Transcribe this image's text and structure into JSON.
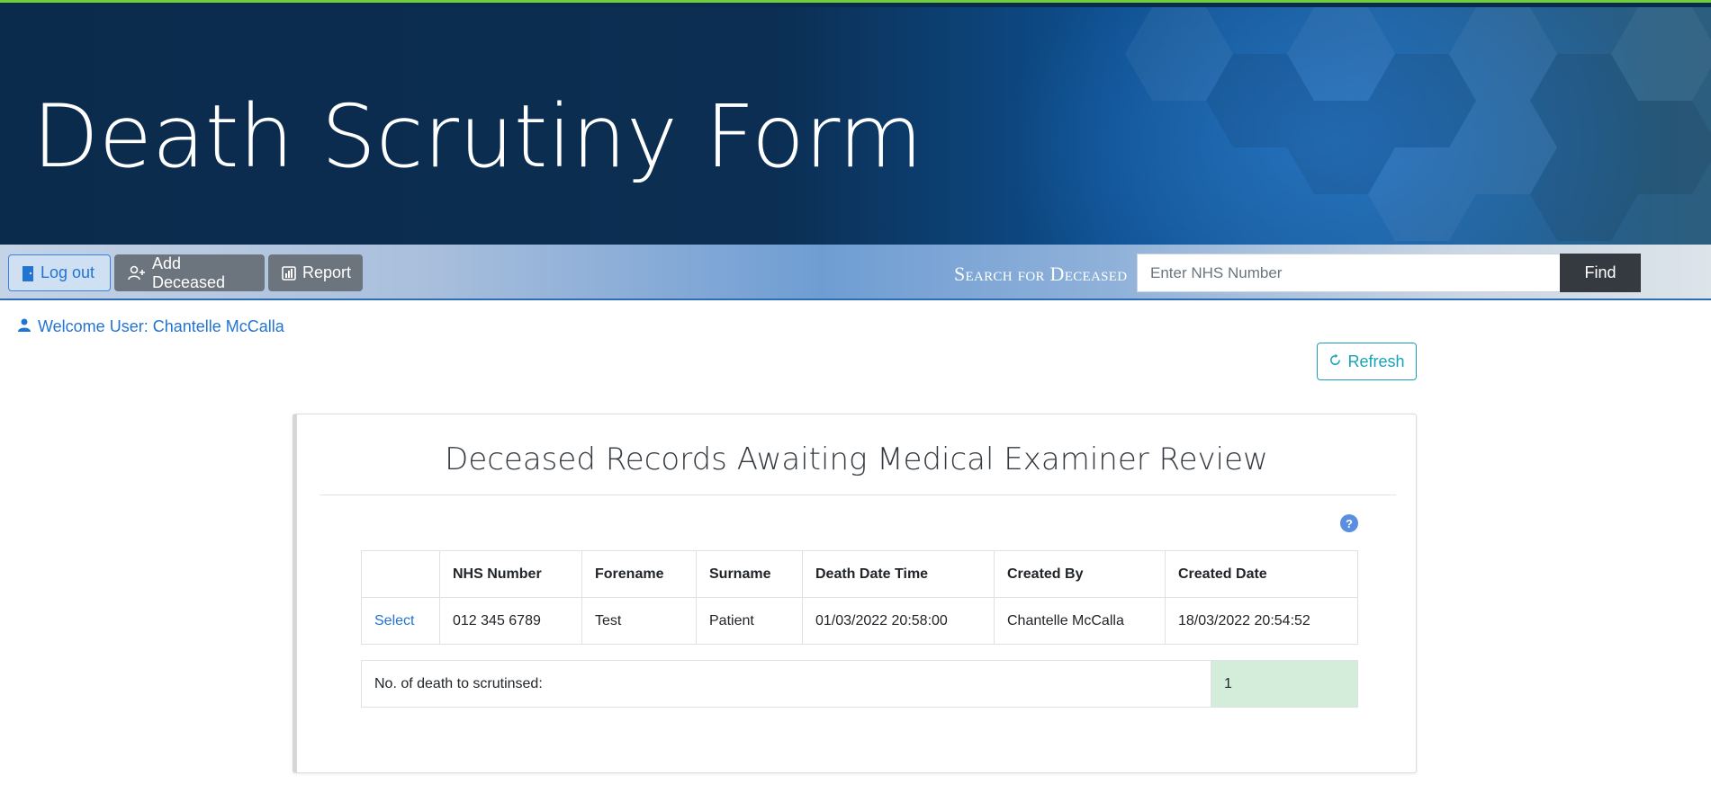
{
  "header": {
    "title": "Death Scrutiny Form"
  },
  "navbar": {
    "logout_label": "Log out",
    "add_deceased_label": "Add Deceased",
    "report_label": "Report",
    "search_label": "Search for Deceased",
    "search_placeholder": "Enter NHS Number",
    "search_value": "",
    "find_label": "Find"
  },
  "user": {
    "welcome_text": "Welcome User: Chantelle McCalla"
  },
  "refresh_label": "Refresh",
  "panel": {
    "title": "Deceased Records Awaiting Medical Examiner Review",
    "help_icon": "?",
    "table": {
      "headers": [
        "",
        "NHS Number",
        "Forename",
        "Surname",
        "Death Date Time",
        "Created By",
        "Created Date"
      ],
      "rows": [
        {
          "action": "Select",
          "nhs_number": "012 345 6789",
          "forename": "Test",
          "surname": "Patient",
          "death_date_time": "01/03/2022 20:58:00",
          "created_by": "Chantelle McCalla",
          "created_date": "18/03/2022 20:54:52"
        }
      ]
    },
    "summary": {
      "label": "No. of death to scrutinsed:",
      "count": "1"
    }
  },
  "colors": {
    "primary_link": "#2274d3",
    "find_button": "#343a40",
    "secondary_button": "#6c757d",
    "refresh_outline": "#17a2b8",
    "count_cell": "#d4edda",
    "accent_line": "#6fcf3a"
  },
  "icons": {
    "logout": "door-icon",
    "add_deceased": "person-plus-icon",
    "report": "chart-icon",
    "welcome": "person-icon",
    "refresh": "refresh-icon",
    "help": "question-icon"
  }
}
